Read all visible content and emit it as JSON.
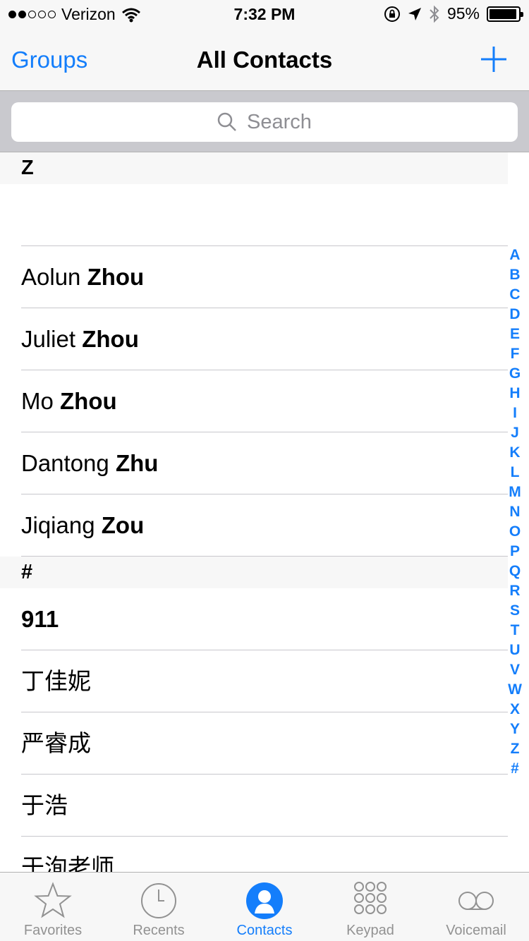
{
  "status_bar": {
    "carrier": "Verizon",
    "time": "7:32 PM",
    "battery_percent": "95%",
    "battery_level": 0.95,
    "signal_bars_filled": 2,
    "signal_bars_total": 5
  },
  "nav": {
    "left_label": "Groups",
    "title": "All Contacts",
    "add_icon": "plus-icon"
  },
  "search": {
    "placeholder": "Search"
  },
  "sections": [
    {
      "header": "Z",
      "contacts": [
        {
          "first": "",
          "last": ""
        },
        {
          "first": "Aolun",
          "last": "Zhou"
        },
        {
          "first": "Juliet",
          "last": "Zhou"
        },
        {
          "first": "Mo",
          "last": "Zhou"
        },
        {
          "first": "Dantong",
          "last": "Zhu"
        },
        {
          "first": "Jiqiang",
          "last": "Zou"
        }
      ]
    },
    {
      "header": "#",
      "contacts": [
        {
          "first": "",
          "last": "911"
        },
        {
          "first": "丁佳妮",
          "last": ""
        },
        {
          "first": "严睿成",
          "last": ""
        },
        {
          "first": "于浩",
          "last": ""
        },
        {
          "first": "于洵老师",
          "last": ""
        }
      ]
    }
  ],
  "index_letters": [
    "A",
    "B",
    "C",
    "D",
    "E",
    "F",
    "G",
    "H",
    "I",
    "J",
    "K",
    "L",
    "M",
    "N",
    "O",
    "P",
    "Q",
    "R",
    "S",
    "T",
    "U",
    "V",
    "W",
    "X",
    "Y",
    "Z",
    "#"
  ],
  "tabs": [
    {
      "label": "Favorites",
      "icon": "star-icon",
      "active": false
    },
    {
      "label": "Recents",
      "icon": "clock-icon",
      "active": false
    },
    {
      "label": "Contacts",
      "icon": "contacts-icon",
      "active": true
    },
    {
      "label": "Keypad",
      "icon": "keypad-icon",
      "active": false
    },
    {
      "label": "Voicemail",
      "icon": "voicemail-icon",
      "active": false
    }
  ],
  "colors": {
    "accent": "#147efb",
    "inactive_tab": "#929292",
    "bar_background": "#f7f7f7",
    "search_background": "#c9c9ce"
  }
}
